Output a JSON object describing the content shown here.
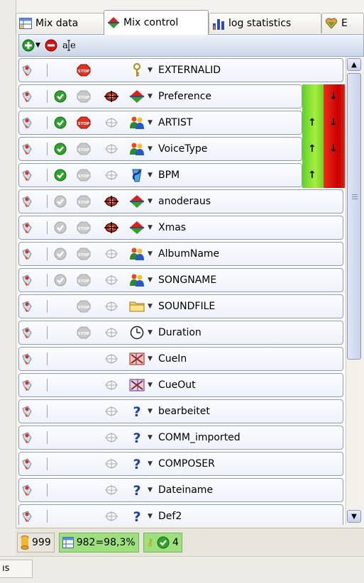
{
  "tabs": [
    {
      "label": "Mix data",
      "icon": "table-icon"
    },
    {
      "label": "Mix control",
      "icon": "balance-icon"
    },
    {
      "label": "log statistics",
      "icon": "bar-chart-icon"
    },
    {
      "label": "E",
      "icon": "heart-icon"
    }
  ],
  "rows": [
    {
      "name": "EXTERNALID",
      "check": "none",
      "stop": "red",
      "target": "none",
      "icon": "key-icon",
      "sorted": false
    },
    {
      "name": "Preference",
      "check": "green",
      "stop": "gray",
      "target": "active",
      "icon": "diamond-arrows-icon",
      "sorted": true
    },
    {
      "name": "ARTIST",
      "check": "green",
      "stop": "red",
      "target": "gray",
      "icon": "people-icon",
      "sorted": true
    },
    {
      "name": "VoiceType",
      "check": "green",
      "stop": "gray",
      "target": "gray",
      "icon": "people-icon",
      "sorted": true
    },
    {
      "name": "BPM",
      "check": "green",
      "stop": "gray",
      "target": "gray",
      "icon": "metronome-icon",
      "sorted": true
    },
    {
      "name": "anoderaus",
      "check": "gray",
      "stop": "gray",
      "target": "active",
      "icon": "diamond-arrows-icon",
      "sorted": false
    },
    {
      "name": "Xmas",
      "check": "gray",
      "stop": "gray",
      "target": "active",
      "icon": "diamond-arrows-icon",
      "sorted": false
    },
    {
      "name": "AlbumName",
      "check": "gray",
      "stop": "gray",
      "target": "gray",
      "icon": "people-icon",
      "sorted": false
    },
    {
      "name": "SONGNAME",
      "check": "gray",
      "stop": "gray",
      "target": "gray",
      "icon": "people-icon",
      "sorted": false
    },
    {
      "name": "SOUNDFILE",
      "check": "none",
      "stop": "gray",
      "target": "gray",
      "icon": "folder-icon",
      "sorted": false
    },
    {
      "name": "Duration",
      "check": "none",
      "stop": "gray",
      "target": "gray",
      "icon": "clock-icon",
      "sorted": false
    },
    {
      "name": "CueIn",
      "check": "none",
      "stop": "none",
      "target": "gray",
      "icon": "cue-in-icon",
      "sorted": false
    },
    {
      "name": "CueOut",
      "check": "none",
      "stop": "none",
      "target": "gray",
      "icon": "cue-out-icon",
      "sorted": false
    },
    {
      "name": "bearbeitet",
      "check": "none",
      "stop": "none",
      "target": "gray",
      "icon": "question-icon",
      "sorted": false
    },
    {
      "name": "COMM_imported",
      "check": "none",
      "stop": "none",
      "target": "gray",
      "icon": "question-icon",
      "sorted": false
    },
    {
      "name": "COMPOSER",
      "check": "none",
      "stop": "none",
      "target": "gray",
      "icon": "question-icon",
      "sorted": false
    },
    {
      "name": "Dateiname",
      "check": "none",
      "stop": "none",
      "target": "gray",
      "icon": "question-icon",
      "sorted": false
    },
    {
      "name": "Def2",
      "check": "none",
      "stop": "none",
      "target": "gray",
      "icon": "question-icon",
      "sorted": false
    }
  ],
  "sort_bars": [
    {
      "row": 1,
      "up": false,
      "down": true
    },
    {
      "row": 2,
      "up": true,
      "down": true
    },
    {
      "row": 3,
      "up": true,
      "down": true
    },
    {
      "row": 4,
      "up": true,
      "down": false
    }
  ],
  "status": {
    "count": "999",
    "ratio": "982=98,3%",
    "checks": "4"
  },
  "bottom_tab": "ıs",
  "colors": {
    "accent": "#316ac5",
    "green": "#5ed12a",
    "red": "#e02010"
  }
}
